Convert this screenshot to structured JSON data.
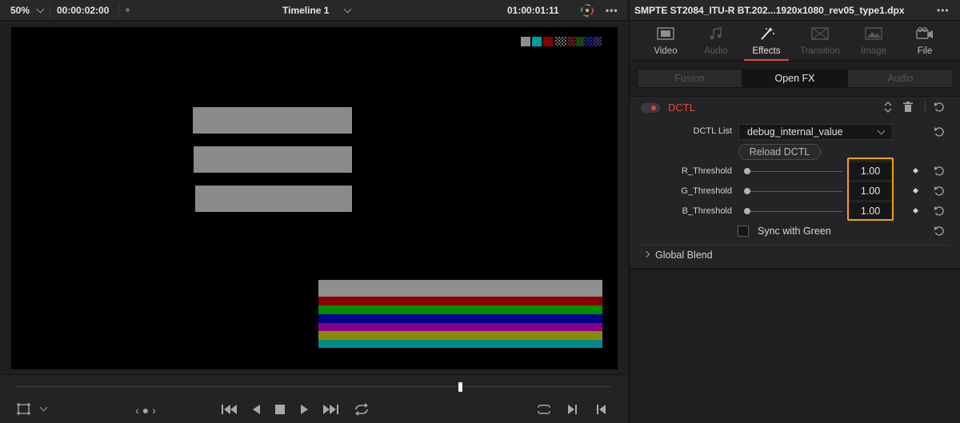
{
  "viewer": {
    "zoom": "50%",
    "timecode_left": "00:00:02:00",
    "timeline_name": "Timeline 1",
    "timecode_right": "01:00:01:11"
  },
  "inspector": {
    "clip_title": "SMPTE ST2084_ITU-R BT.202...1920x1080_rev05_type1.dpx",
    "tabs": [
      {
        "label": "Video",
        "icon": "film-icon",
        "state": "normal"
      },
      {
        "label": "Audio",
        "icon": "music-note-icon",
        "state": "disabled"
      },
      {
        "label": "Effects",
        "icon": "magic-wand-icon",
        "state": "active"
      },
      {
        "label": "Transition",
        "icon": "transition-icon",
        "state": "disabled"
      },
      {
        "label": "Image",
        "icon": "image-icon",
        "state": "disabled"
      },
      {
        "label": "File",
        "icon": "camera-icon",
        "state": "normal"
      }
    ],
    "subtabs": [
      {
        "label": "Fusion",
        "state": "disabled"
      },
      {
        "label": "Open FX",
        "state": "active"
      },
      {
        "label": "Audio",
        "state": "disabled"
      }
    ],
    "effect": {
      "name": "DCTL",
      "enabled": true,
      "dctl_list_label": "DCTL List",
      "dctl_list_value": "debug_internal_value",
      "reload_label": "Reload DCTL",
      "params": [
        {
          "label": "R_Threshold",
          "value": "1.00"
        },
        {
          "label": "G_Threshold",
          "value": "1.00"
        },
        {
          "label": "B_Threshold",
          "value": "1.00"
        }
      ],
      "sync_label": "Sync with Green",
      "sync_checked": false
    },
    "global_blend_label": "Global Blend"
  },
  "colors": {
    "accent_red": "#e8453c",
    "highlight_orange": "#f3a10f"
  }
}
